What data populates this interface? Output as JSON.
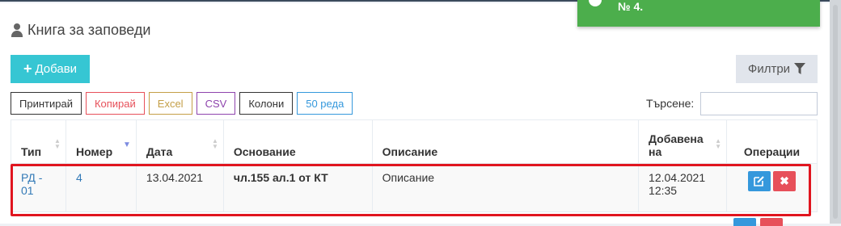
{
  "notification": {
    "text": "№ 4."
  },
  "page": {
    "title": "Книга за заповеди"
  },
  "actions": {
    "add_label": "Добави",
    "filter_label": "Филтри"
  },
  "export_buttons": [
    {
      "label": "Принтирай",
      "color": "#333333"
    },
    {
      "label": "Копирай",
      "color": "#e7505a"
    },
    {
      "label": "Excel",
      "color": "#c49f47"
    },
    {
      "label": "CSV",
      "color": "#8e44ad"
    },
    {
      "label": "Колони",
      "color": "#333333"
    },
    {
      "label": "50 реда",
      "color": "#3598dc"
    }
  ],
  "search": {
    "label": "Търсене:",
    "value": ""
  },
  "table": {
    "columns": [
      "Тип",
      "Номер",
      "Дата",
      "Основание",
      "Описание",
      "Добавена на",
      "Операции"
    ],
    "sorted_column": "Номер",
    "rows": [
      {
        "type": "РД - 01",
        "number": "4",
        "date": "13.04.2021",
        "basis": "чл.155 ал.1 от КТ",
        "description": "Описание",
        "added_date": "12.04.2021",
        "added_time": "12:35"
      }
    ]
  },
  "colors": {
    "accent": "#36c6d3",
    "highlight": "#e0151f",
    "toast": "#4cae4c",
    "edit": "#3598dc",
    "delete": "#e7505a"
  }
}
